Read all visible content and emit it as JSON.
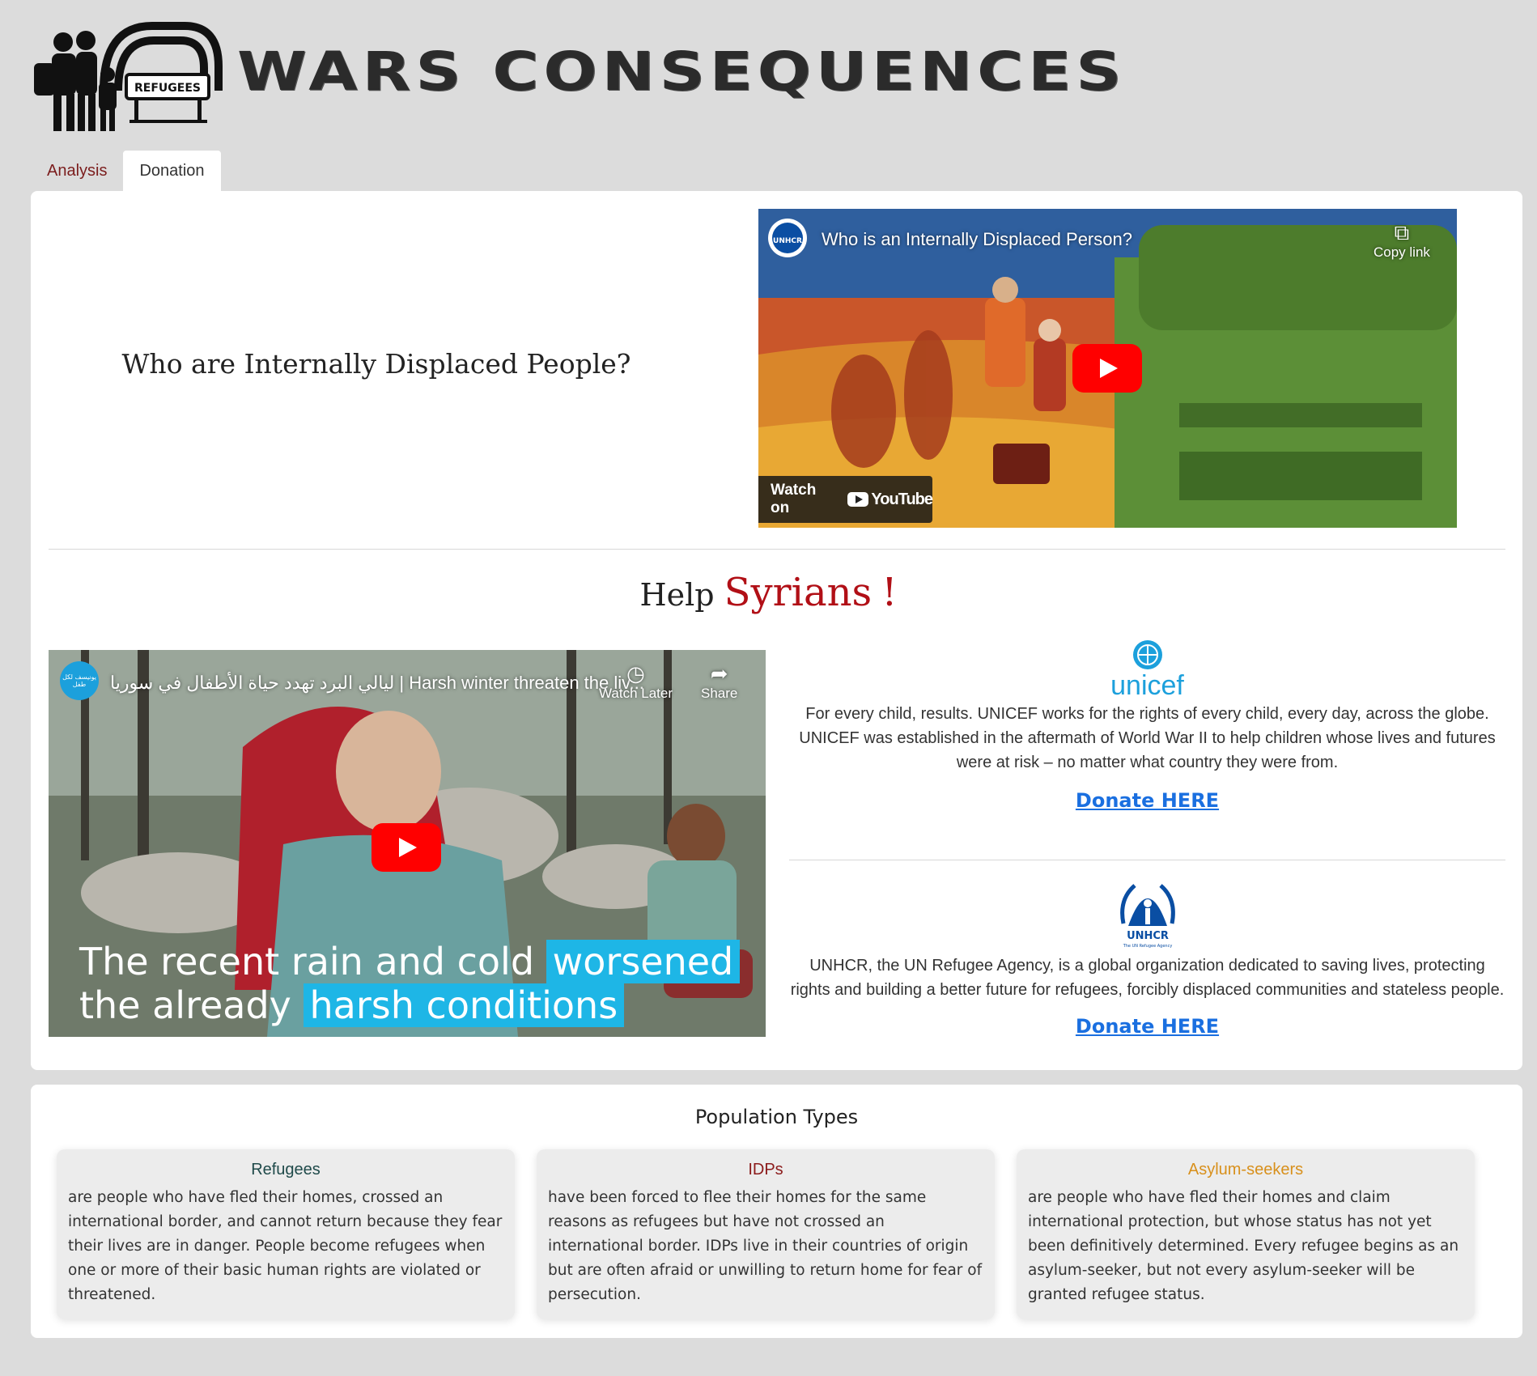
{
  "header": {
    "site_title": "WARS CONSEQUENCES",
    "logo_sign": "REFUGEES"
  },
  "tabs": [
    {
      "label": "Analysis",
      "active": false
    },
    {
      "label": "Donation",
      "active": true
    }
  ],
  "idp_section": {
    "question": "Who are Internally Displaced People?",
    "video": {
      "title": "Who is an Internally Displaced Person?",
      "channel": "UNHCR",
      "copy_link_label": "Copy link",
      "watch_on_label": "Watch on",
      "youtube_label": "YouTube"
    }
  },
  "help": {
    "prefix": "Help",
    "highlight": "Syrians",
    "suffix": "!",
    "video": {
      "title": "ليالي البرد تهدد حياة الأطفال في سوريا | Harsh winter threaten the liv...",
      "channel_label": "يونيسف لكل طفل",
      "watch_later_label": "Watch Later",
      "share_label": "Share",
      "caption_line1_plain": "The recent rain and cold",
      "caption_line1_hl": "worsened",
      "caption_line2_plain": "the already",
      "caption_line2_hl": "harsh conditions"
    }
  },
  "organizations": {
    "unicef": {
      "name": "unicef",
      "description": "For every child, results. UNICEF works for the rights of every child, every day, across the globe. UNICEF was established in the aftermath of World War II to help children whose lives and futures were at risk – no matter what country they were from.",
      "donate_label": "Donate HERE"
    },
    "unhcr": {
      "name": "UNHCR",
      "tagline": "The UN Refugee Agency",
      "description": "UNHCR, the UN Refugee Agency, is a global organization dedicated to saving lives, protecting rights and building a better future for refugees, forcibly displaced communities and stateless people.",
      "donate_label": "Donate HERE"
    }
  },
  "population": {
    "title": "Population Types",
    "cards": [
      {
        "title": "Refugees",
        "color": "#1f4a4a",
        "text": "are people who have fled their homes, crossed an international border, and cannot return because they fear their lives are in danger. People become refugees when one or more of their basic human rights are violated or threatened."
      },
      {
        "title": "IDPs",
        "color": "#8b1a1a",
        "text": "have been forced to flee their homes for the same reasons as refugees but have not crossed an international border. IDPs live in their countries of origin but are often afraid or unwilling to return home for fear of persecution."
      },
      {
        "title": "Asylum-seekers",
        "color": "#d8901c",
        "text": "are people who have fled their homes and claim international protection, but whose status has not yet been definitively determined. Every refugee begins as an asylum-seeker, but not every asylum-seeker will be granted refugee status."
      }
    ]
  },
  "colors": {
    "page_bg": "#dcdcdc",
    "accent_red": "#b10f16",
    "link_blue": "#1a6fe0",
    "unicef_blue": "#1ca0dc",
    "unhcr_blue": "#0a4ea3",
    "youtube_red": "#ff0000"
  }
}
